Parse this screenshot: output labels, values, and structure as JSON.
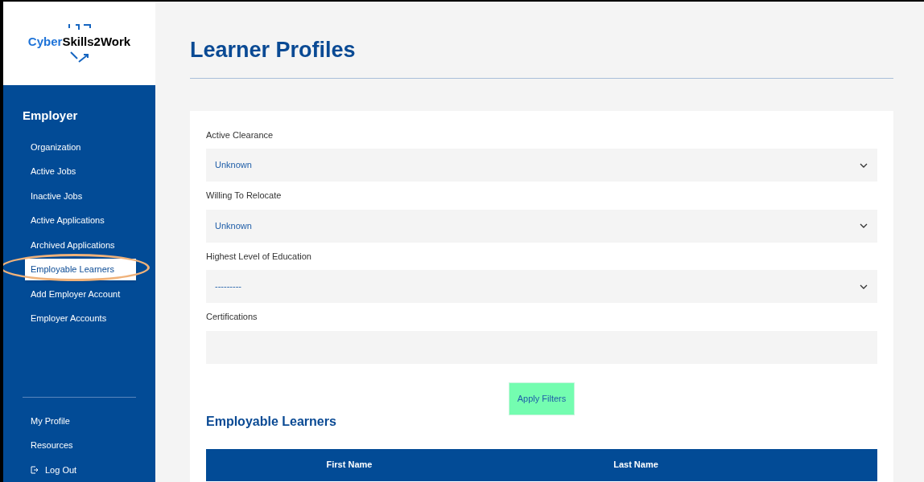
{
  "logo": {
    "text_a": "Cyber",
    "text_b": "Skills2Work"
  },
  "sidebar": {
    "heading": "Employer",
    "items": [
      {
        "label": "Organization",
        "selected": false
      },
      {
        "label": "Active Jobs",
        "selected": false
      },
      {
        "label": "Inactive Jobs",
        "selected": false
      },
      {
        "label": "Active Applications",
        "selected": false
      },
      {
        "label": "Archived Applications",
        "selected": false
      },
      {
        "label": "Employable Learners",
        "selected": true
      },
      {
        "label": "Add Employer Account",
        "selected": false
      },
      {
        "label": "Employer Accounts",
        "selected": false
      }
    ],
    "footer_items": [
      {
        "label": "My Profile"
      },
      {
        "label": "Resources"
      },
      {
        "label": "Log Out",
        "kind": "logout"
      }
    ]
  },
  "page": {
    "title": "Learner Profiles"
  },
  "filters": [
    {
      "label": "Active Clearance",
      "kind": "select",
      "value": "Unknown"
    },
    {
      "label": "Willing To Relocate",
      "kind": "select",
      "value": "Unknown"
    },
    {
      "label": "Highest Level of Education",
      "kind": "select",
      "value": "---------"
    },
    {
      "label": "Certifications",
      "kind": "text"
    }
  ],
  "apply_button": "Apply Filters",
  "results": {
    "title": "Employable Learners",
    "columns": [
      "First Name",
      "Last Name"
    ]
  }
}
